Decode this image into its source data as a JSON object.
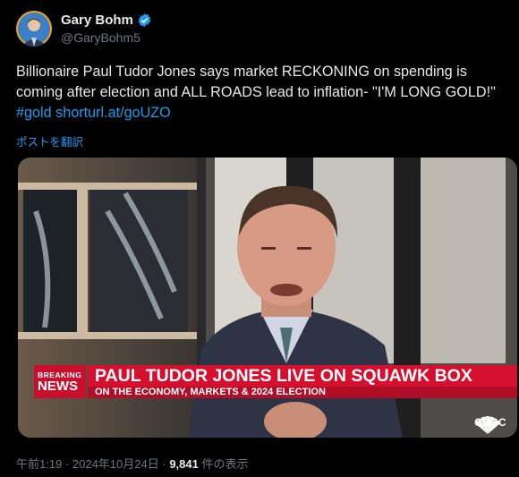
{
  "author": {
    "display_name": "Gary Bohm",
    "handle": "@GaryBohm5",
    "verified": true
  },
  "tweet": {
    "text": "Billionaire Paul Tudor Jones says market RECKONING on spending is coming after election and ALL ROADS lead to inflation- \"I'M LONG GOLD!\"",
    "hashtag": "#gold",
    "link": "shorturl.at/goUZO",
    "translate_label": "ポストを翻訳"
  },
  "media": {
    "breaking_line1": "BREAKING",
    "breaking_line2": "NEWS",
    "headline": "PAUL TUDOR JONES LIVE ON SQUAWK BOX",
    "subline": "ON THE ECONOMY, MARKETS & 2024 ELECTION",
    "network_logo": "CNBC"
  },
  "meta": {
    "time": "午前1:19",
    "date": "2024年10月24日",
    "views_count": "9,841",
    "views_label": "件の表示"
  },
  "colors": {
    "link": "#1d9bf0",
    "breaking_red": "#c8102e",
    "verified_blue": "#1d9bf0"
  }
}
